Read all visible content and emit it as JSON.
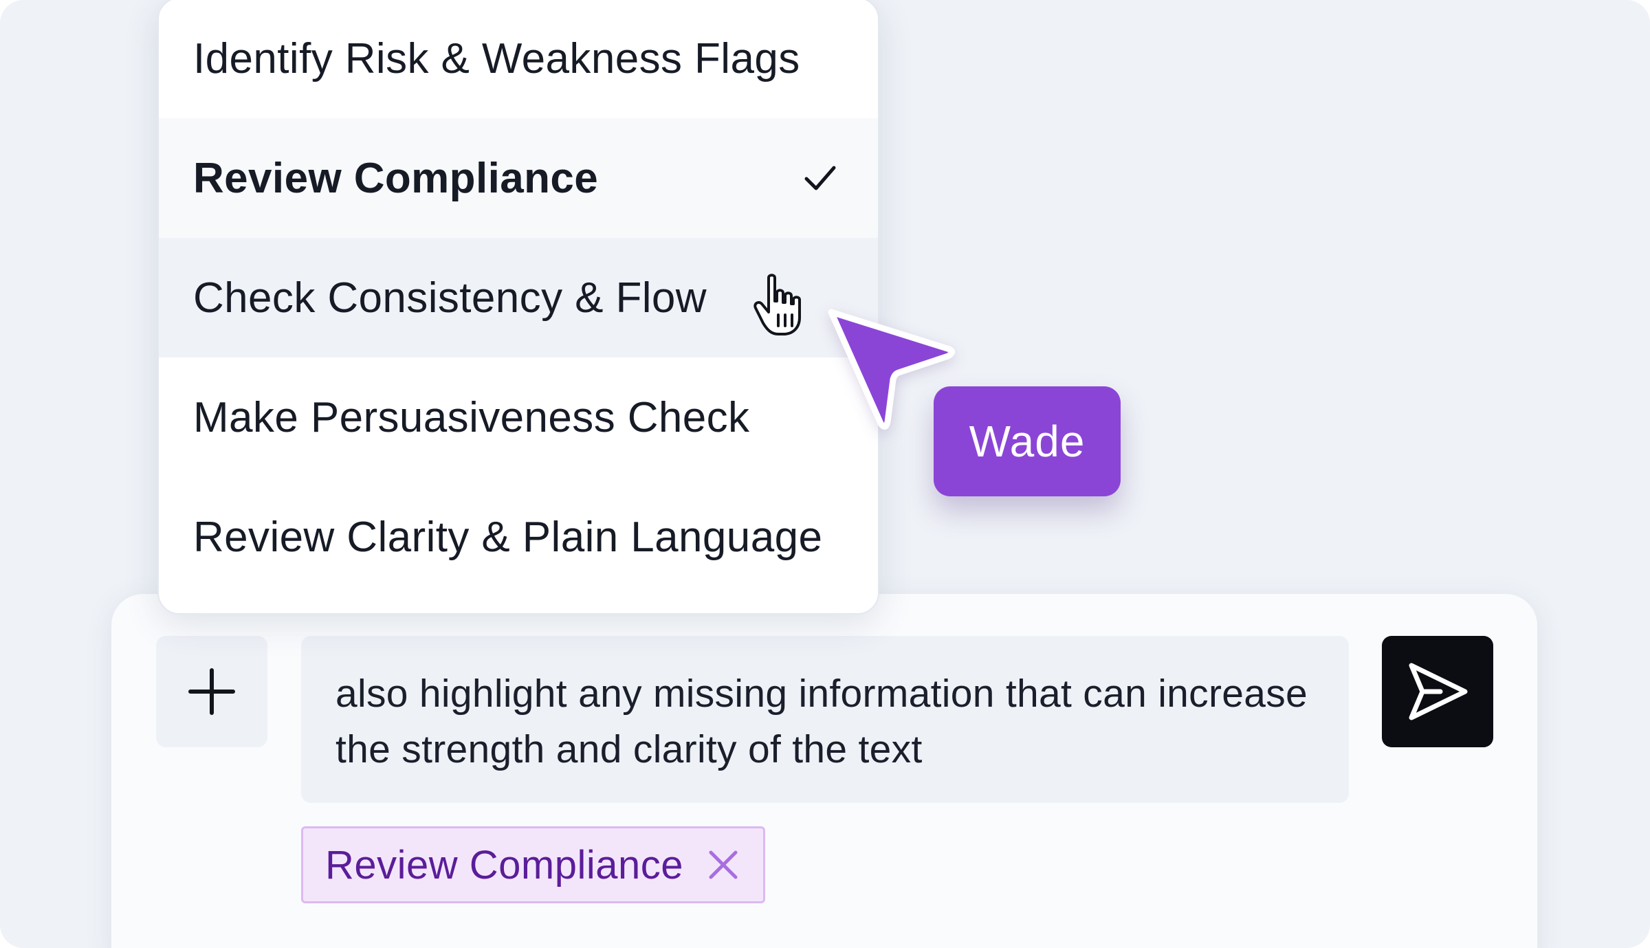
{
  "menu": {
    "items": [
      {
        "label": "Identify Risk & Weakness Flags",
        "state": "normal"
      },
      {
        "label": "Review Compliance",
        "state": "selected"
      },
      {
        "label": "Check Consistency & Flow",
        "state": "hovered"
      },
      {
        "label": "Make Persuasiveness Check",
        "state": "normal"
      },
      {
        "label": "Review Clarity & Plain Language",
        "state": "normal"
      }
    ],
    "check_icon": "check-icon"
  },
  "collaborator": {
    "name": "Wade",
    "color": "#8B45D6",
    "pointer_icon": "arrow-pointer-icon"
  },
  "composer": {
    "attach_icon": "plus-icon",
    "message_text": "also highlight any missing information that can increase the strength and clarity of the text",
    "send_icon": "send-icon",
    "tag": {
      "label": "Review Compliance",
      "close_icon": "close-icon",
      "color": "#5B1D99",
      "background": "#F3E6FB"
    }
  },
  "colors": {
    "background": "#EFF2F7",
    "accent": "#8B45D6",
    "send_button": "#0B0D12"
  }
}
